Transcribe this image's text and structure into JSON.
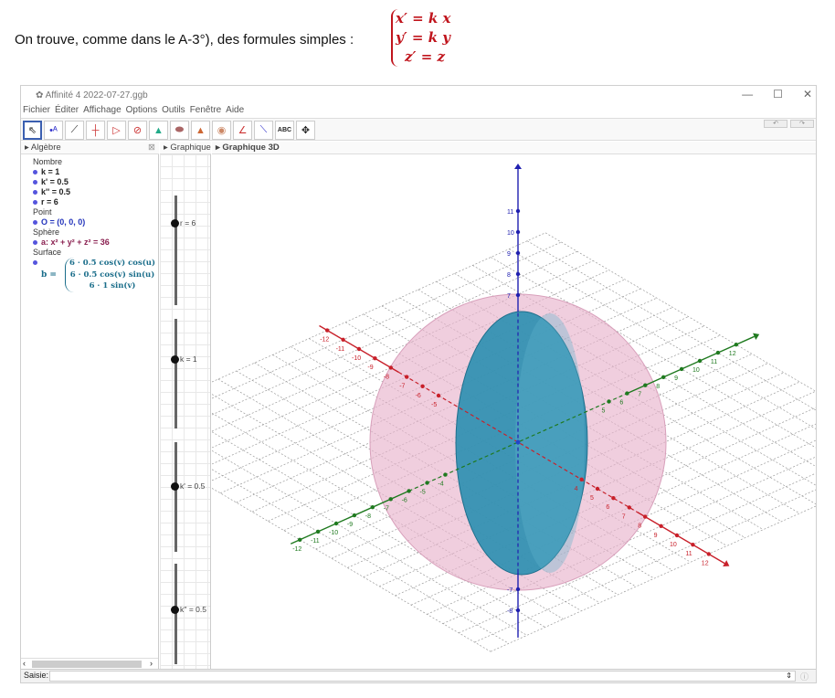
{
  "intro": "On trouve, comme dans le A-3°), des formules simples :",
  "formula": [
    "x′ = k x",
    "y′ = k y",
    "z′ = z"
  ],
  "window": {
    "title": "Affinité 4 2022-07-27.ggb",
    "controls": [
      "—",
      "☐",
      "✕"
    ]
  },
  "menu": [
    "Fichier",
    "Éditer",
    "Affichage",
    "Options",
    "Outils",
    "Fenêtre",
    "Aide"
  ],
  "tools": [
    "move",
    "point",
    "line",
    "perpendicular",
    "polygon",
    "circle",
    "pyramid",
    "intersect",
    "plane",
    "sphere",
    "angle",
    "reflect",
    "text",
    "rotate-view"
  ],
  "tool_text": "ABC",
  "panels": {
    "algebra": "Algèbre",
    "graphics": "Graphique",
    "graphics3d": "Graphique 3D"
  },
  "algebra": {
    "groups": [
      {
        "name": "Nombre",
        "items": [
          "k = 1",
          "k' = 0.5",
          "k'' = 0.5",
          "r = 6"
        ]
      },
      {
        "name": "Point",
        "items": [
          "O = (0, 0, 0)"
        ]
      },
      {
        "name": "Sphère",
        "items": [
          "a: x² + y² + z² = 36"
        ]
      },
      {
        "name": "Surface",
        "items": []
      }
    ],
    "surface": {
      "label": "b =",
      "rows": [
        "6 · 0.5 cos(v) cos(u)",
        "6 · 0.5 cos(v) sin(u)",
        "6 · 1 sin(v)"
      ]
    }
  },
  "sliders": [
    {
      "label": "r = 6",
      "fraction": 0.25
    },
    {
      "label": "k = 1",
      "fraction": 0.35
    },
    {
      "label": "k' = 0.5",
      "fraction": 0.38
    },
    {
      "label": "k'' = 0.5",
      "fraction": 0.44
    }
  ],
  "input": {
    "label": "Saisie:",
    "value": ""
  },
  "scene": {
    "colors": {
      "x": "#c8202a",
      "y": "#1f7a1f",
      "z": "#2020b0",
      "sphere": "#e8b4cc",
      "ellipsoid": "#2a8fb0"
    },
    "sphere_radius": 6,
    "k": 1,
    "k1": 0.5,
    "k2": 0.5,
    "x_ticks": [
      -12,
      -11,
      -10,
      -9,
      -8,
      -7,
      -6,
      -5,
      4,
      5,
      6,
      7,
      8,
      9,
      10,
      11,
      12
    ],
    "y_ticks": [
      -12,
      -11,
      -10,
      -9,
      -8,
      -7,
      -6,
      -5,
      -4,
      5,
      6,
      7,
      8,
      9,
      10,
      11,
      12
    ],
    "z_ticks": [
      7,
      8,
      9,
      10,
      11,
      -7,
      -8
    ]
  }
}
